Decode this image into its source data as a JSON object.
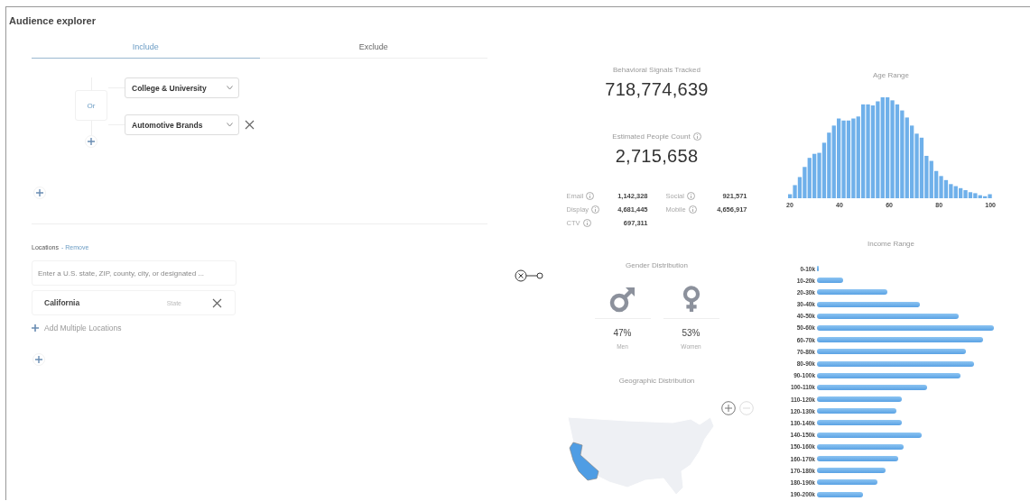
{
  "title": "Audience explorer",
  "tabs": [
    {
      "label": "Include",
      "selected": true
    },
    {
      "label": "Exclude",
      "selected": false
    }
  ],
  "rule_group": {
    "operator": "Or",
    "conditions": [
      {
        "value": "College & University",
        "removable": false
      },
      {
        "value": "Automotive Brands",
        "removable": true
      }
    ]
  },
  "locations": {
    "label": "Locations",
    "remove_link": "- Remove",
    "search": {
      "placeholder": "Enter a U.S. state, ZIP, county, city, or designated ..."
    },
    "selected": [
      {
        "name": "California",
        "type": "State"
      }
    ],
    "add_multiple": "Add Multiple Locations"
  },
  "stats": {
    "signals": {
      "label": "Behavioral Signals Tracked",
      "value": "718,774,639"
    },
    "people": {
      "label": "Estimated People Count",
      "value": "2,715,658"
    },
    "channels": [
      {
        "name": "Email",
        "value": "1,142,328"
      },
      {
        "name": "Social",
        "value": "921,571"
      },
      {
        "name": "Display",
        "value": "4,681,445"
      },
      {
        "name": "Mobile",
        "value": "4,656,917"
      },
      {
        "name": "CTV",
        "value": "697,311"
      }
    ]
  },
  "gender": {
    "title": "Gender Distribution",
    "items": [
      {
        "kind": "male",
        "percent": "47%",
        "label": "Men"
      },
      {
        "kind": "female",
        "percent": "53%",
        "label": "Women"
      }
    ]
  },
  "geo": {
    "title": "Geographic Distribution"
  },
  "age": {
    "title": "Age Range",
    "axis_labels": [
      "20",
      "40",
      "60",
      "80",
      "100"
    ]
  },
  "income": {
    "title": "Income Range",
    "categories": [
      "0-10k",
      "10-20k",
      "20-30k",
      "30-40k",
      "40-50k",
      "50-60k",
      "60-70k",
      "70-80k",
      "80-90k",
      "90-100k",
      "100-110k",
      "110-120k",
      "120-130k",
      "130-140k",
      "140-150k",
      "150-160k",
      "160-170k",
      "170-180k",
      "180-190k",
      "190-200k"
    ]
  }
}
